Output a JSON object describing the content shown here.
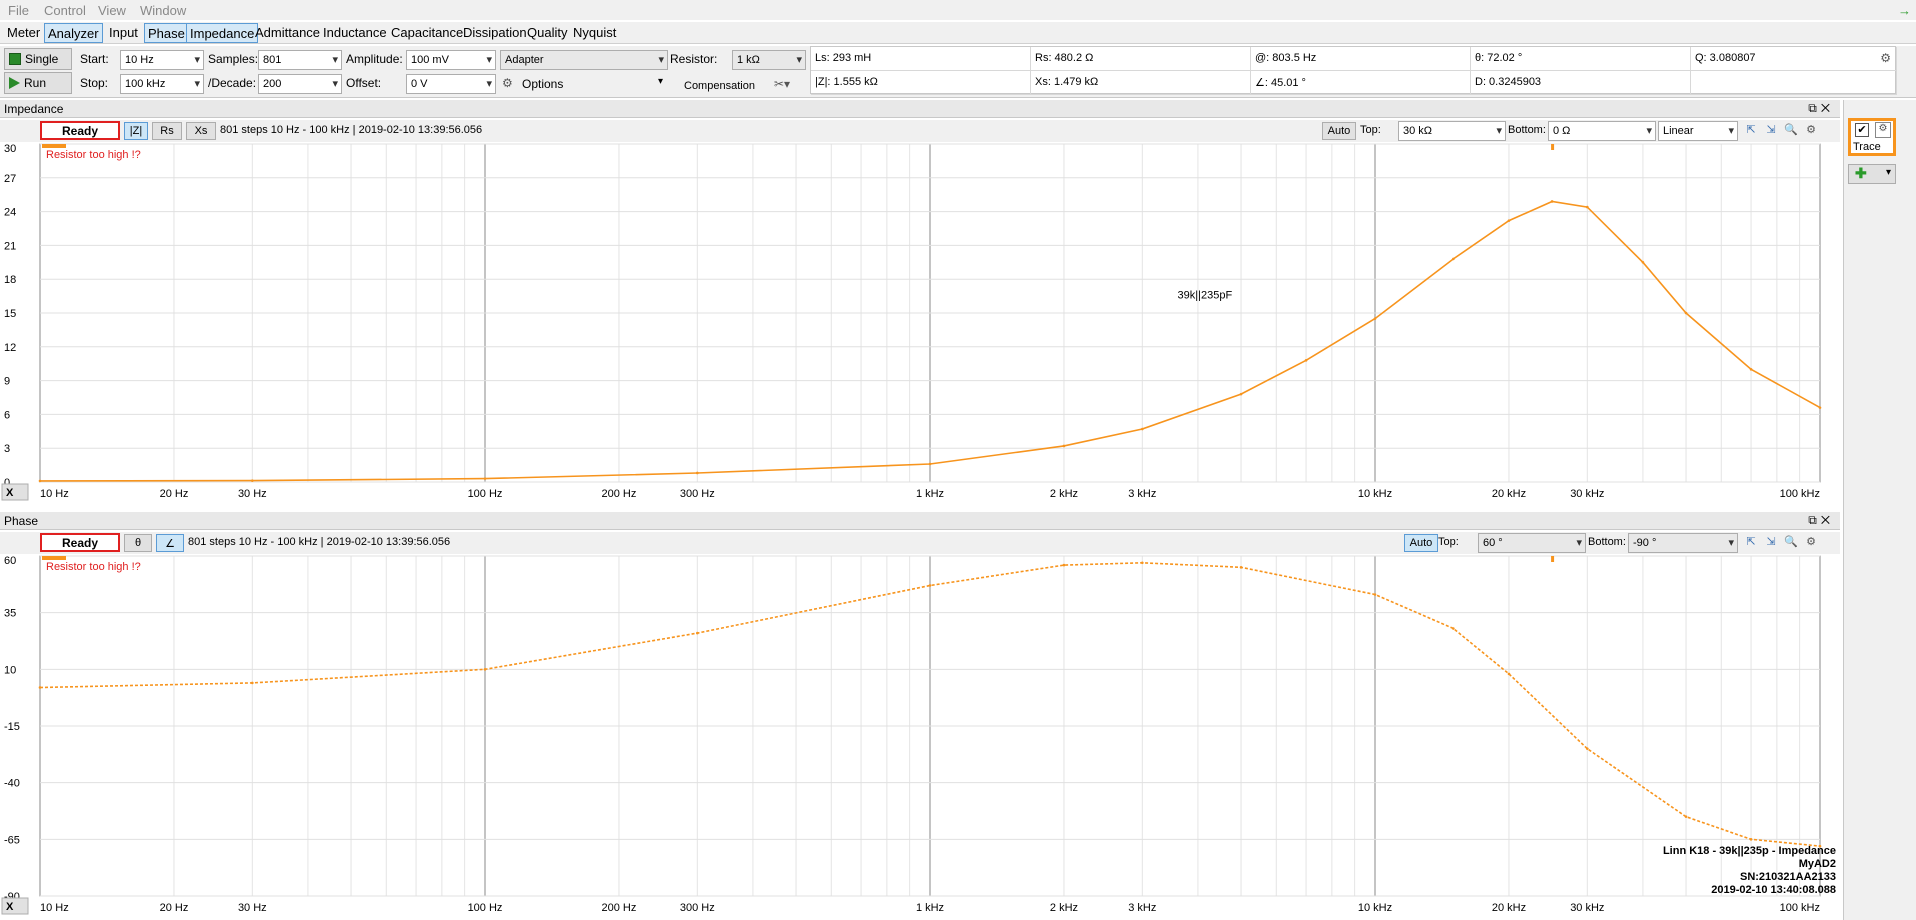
{
  "menu": [
    "File",
    "Control",
    "View",
    "Window"
  ],
  "tabs": [
    {
      "label": "Meter",
      "selected": false
    },
    {
      "label": "Analyzer",
      "selected": true
    },
    {
      "label": "Input",
      "selected": false
    },
    {
      "label": "Phase",
      "selected": true
    },
    {
      "label": "Impedance",
      "selected": true
    },
    {
      "label": "Admittance",
      "selected": false
    },
    {
      "label": "Inductance",
      "selected": false
    },
    {
      "label": "Capacitance",
      "selected": false
    },
    {
      "label": "Dissipation",
      "selected": false
    },
    {
      "label": "Quality",
      "selected": false
    },
    {
      "label": "Nyquist",
      "selected": false
    }
  ],
  "controls": {
    "single_label": "Single",
    "run_label": "Run",
    "start_label": "Start:",
    "start_value": "10 Hz",
    "stop_label": "Stop:",
    "stop_value": "100 kHz",
    "samples_label": "Samples:",
    "samples_value": "801",
    "decade_label": "/Decade:",
    "decade_value": "200",
    "amplitude_label": "Amplitude:",
    "amplitude_value": "100 mV",
    "offset_label": "Offset:",
    "offset_value": "0 V",
    "adapter_value": "Adapter",
    "options_label": "Options",
    "resistor_label": "Resistor:",
    "resistor_value": "1 kΩ",
    "compensation_label": "Compensation"
  },
  "measurements": [
    [
      "Ls: 293 mH",
      "Rs: 480.2 Ω",
      "@: 803.5 Hz",
      "θ: 72.02 °",
      "Q: 3.080807"
    ],
    [
      "|Z|: 1.555 kΩ",
      "Xs: 1.479 kΩ",
      "∠: 45.01 °",
      "D: 0.3245903",
      ""
    ]
  ],
  "impedance_panel": {
    "title": "Impedance",
    "status": "Ready",
    "buttons": [
      "|Z|",
      "Rs",
      "Xs"
    ],
    "info": "801 steps 10 Hz - 100 kHz | 2019-02-10 13:39:56.056",
    "auto_label": "Auto",
    "top_label": "Top:",
    "top_value": "30 kΩ",
    "bottom_label": "Bottom:",
    "bottom_value": "0 Ω",
    "scale_value": "Linear",
    "unit": "kΩ",
    "warning": "Resistor too high !?",
    "annotation": "39k||235pF"
  },
  "phase_panel": {
    "title": "Phase",
    "status": "Ready",
    "buttons": [
      "θ",
      "∠"
    ],
    "info": "801 steps 10 Hz - 100 kHz | 2019-02-10 13:39:56.056",
    "auto_label": "Auto",
    "top_label": "Top:",
    "top_value": "60 °",
    "bottom_label": "Bottom:",
    "bottom_value": "-90 °",
    "unit": "°",
    "warning": "Resistor too high !?"
  },
  "side": {
    "trace_label": "Trace"
  },
  "x_axis_selector": "X",
  "watermark": [
    "Linn K18 - 39k||235p - Impedance",
    "MyAD2",
    "SN:210321AA2133",
    "2019-02-10 13:40:08.088"
  ],
  "chart_data": [
    {
      "type": "line",
      "x_scale": "log",
      "xlim": [
        10,
        100000
      ],
      "ylim": [
        0,
        30
      ],
      "x_tick_labels": [
        "10 Hz",
        "20 Hz",
        "30 Hz",
        "100 Hz",
        "200 Hz",
        "300 Hz",
        "1 kHz",
        "2 kHz",
        "3 kHz",
        "10 kHz",
        "20 kHz",
        "30 kHz",
        "100 kHz"
      ],
      "x_ticks": [
        10,
        20,
        30,
        100,
        200,
        300,
        1000,
        2000,
        3000,
        10000,
        20000,
        30000,
        100000
      ],
      "y_ticks": [
        0,
        3,
        6,
        9,
        12,
        15,
        18,
        21,
        24,
        27,
        30
      ],
      "ylabel": "kΩ",
      "grid": true,
      "color": "#f7941d",
      "series": [
        {
          "name": "39k||235pF",
          "x": [
            10,
            30,
            100,
            300,
            1000,
            2000,
            3000,
            5000,
            7000,
            10000,
            15000,
            20000,
            25000,
            30000,
            40000,
            50000,
            70000,
            100000
          ],
          "y": [
            0.1,
            0.12,
            0.3,
            0.8,
            1.6,
            3.2,
            4.7,
            7.8,
            10.8,
            14.5,
            19.8,
            23.2,
            24.9,
            24.4,
            19.5,
            15.0,
            10.0,
            6.6
          ]
        }
      ]
    },
    {
      "type": "line",
      "x_scale": "log",
      "xlim": [
        10,
        100000
      ],
      "ylim": [
        -90,
        60
      ],
      "x_tick_labels": [
        "10 Hz",
        "20 Hz",
        "30 Hz",
        "100 Hz",
        "200 Hz",
        "300 Hz",
        "1 kHz",
        "2 kHz",
        "3 kHz",
        "10 kHz",
        "20 kHz",
        "30 kHz",
        "100 kHz"
      ],
      "x_ticks": [
        10,
        20,
        30,
        100,
        200,
        300,
        1000,
        2000,
        3000,
        10000,
        20000,
        30000,
        100000
      ],
      "y_ticks": [
        60,
        35,
        10,
        -15,
        -40,
        -65,
        -90
      ],
      "ylabel": "°",
      "grid": true,
      "color": "#f7941d",
      "series": [
        {
          "name": "",
          "x": [
            10,
            30,
            100,
            300,
            1000,
            2000,
            3000,
            5000,
            10000,
            15000,
            20000,
            30000,
            50000,
            70000,
            100000
          ],
          "y": [
            2,
            4,
            10,
            26,
            47,
            56,
            57,
            55,
            43,
            28,
            8,
            -25,
            -55,
            -65,
            -68
          ]
        }
      ]
    }
  ]
}
